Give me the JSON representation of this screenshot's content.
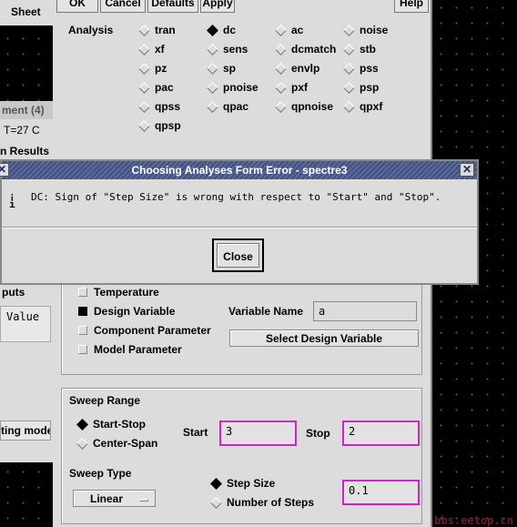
{
  "left_window": {
    "menu_sheet": "Sheet",
    "title_partial": "ment (4)",
    "temperature": "T=27 C",
    "results_partial": "n   Results",
    "outputs_partial": "puts",
    "value_header": "Value",
    "mode_partial": "ting mode"
  },
  "analyses_form": {
    "buttons": [
      "OK",
      "Cancel",
      "Defaults",
      "Apply",
      "Help"
    ],
    "analysis_label": "Analysis",
    "analysis_options": [
      {
        "label": "tran",
        "selected": false
      },
      {
        "label": "dc",
        "selected": true
      },
      {
        "label": "ac",
        "selected": false
      },
      {
        "label": "noise",
        "selected": false
      },
      {
        "label": "xf",
        "selected": false
      },
      {
        "label": "sens",
        "selected": false
      },
      {
        "label": "dcmatch",
        "selected": false
      },
      {
        "label": "stb",
        "selected": false
      },
      {
        "label": "pz",
        "selected": false
      },
      {
        "label": "sp",
        "selected": false
      },
      {
        "label": "envlp",
        "selected": false
      },
      {
        "label": "pss",
        "selected": false
      },
      {
        "label": "pac",
        "selected": false
      },
      {
        "label": "pnoise",
        "selected": false
      },
      {
        "label": "pxf",
        "selected": false
      },
      {
        "label": "psp",
        "selected": false
      },
      {
        "label": "qpss",
        "selected": false
      },
      {
        "label": "qpac",
        "selected": false
      },
      {
        "label": "qpnoise",
        "selected": false
      },
      {
        "label": "qpxf",
        "selected": false
      },
      {
        "label": "qpsp",
        "selected": false
      }
    ],
    "sweep_variable": {
      "temperature": "Temperature",
      "design_variable": "Design Variable",
      "component_parameter": "Component Parameter",
      "model_parameter": "Model Parameter",
      "selected": "Design Variable",
      "variable_name_label": "Variable Name",
      "variable_name_value": "a",
      "select_button": "Select Design Variable"
    },
    "sweep_range": {
      "label": "Sweep Range",
      "start_stop": "Start-Stop",
      "center_span": "Center-Span",
      "selected": "Start-Stop",
      "start_label": "Start",
      "start_value": "3",
      "stop_label": "Stop",
      "stop_value": "2"
    },
    "sweep_type": {
      "label": "Sweep Type",
      "value": "Linear",
      "step_size": "Step Size",
      "number_of_steps": "Number of Steps",
      "selected": "Step Size",
      "step_value": "0.1"
    }
  },
  "error_dialog": {
    "title": "Choosing Analyses Form Error - spectre3",
    "message": "DC: Sign of \"Step Size\" is wrong with respect to \"Start\" and \"Stop\".",
    "close_button": "Close"
  },
  "watermark": "bbs.eetop.cn",
  "colors": {
    "background": "#000000",
    "window_gray": "#dcdcdc",
    "title_bar": "#4a5a8a",
    "highlight_border": "#d020d0"
  }
}
